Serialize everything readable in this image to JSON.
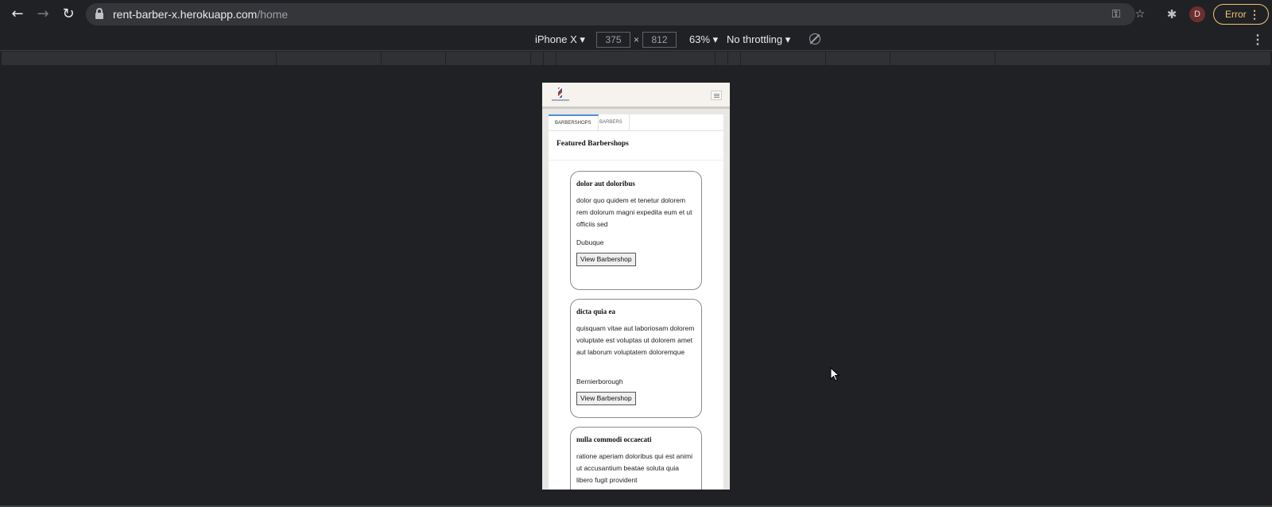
{
  "browser": {
    "url_host": "rent-barber-x.herokuapp.com",
    "url_path": "/home",
    "profile_initial": "D",
    "error_label": "Error"
  },
  "devtools": {
    "device": "iPhone X",
    "width": "375",
    "height": "812",
    "zoom": "63%",
    "throttling": "No throttling"
  },
  "app": {
    "tabs": [
      {
        "label": "BARBERSHOPS",
        "active": true
      },
      {
        "label": "BARBERS",
        "active": false
      }
    ],
    "section_title": "Featured Barbershops",
    "cards": [
      {
        "name": "dolor aut doloribus",
        "description": "dolor quo quidem et tenetur dolorem rem dolorum magni expedita eum et ut officiis sed",
        "city": "Dubuque",
        "button": "View Barbershop"
      },
      {
        "name": "dicta quia ea",
        "description": "quisquam vitae aut laboriosam dolorem voluptate est voluptas ut dolorem amet aut laborum voluptatem doloremque",
        "city": "Bernierborough",
        "button": "View Barbershop"
      },
      {
        "name": "nulla commodi occaecati",
        "description": "ratione aperiam doloribus qui est animi ut accusantium beatae soluta quia libero fugit provident",
        "city": "",
        "button": ""
      }
    ]
  }
}
